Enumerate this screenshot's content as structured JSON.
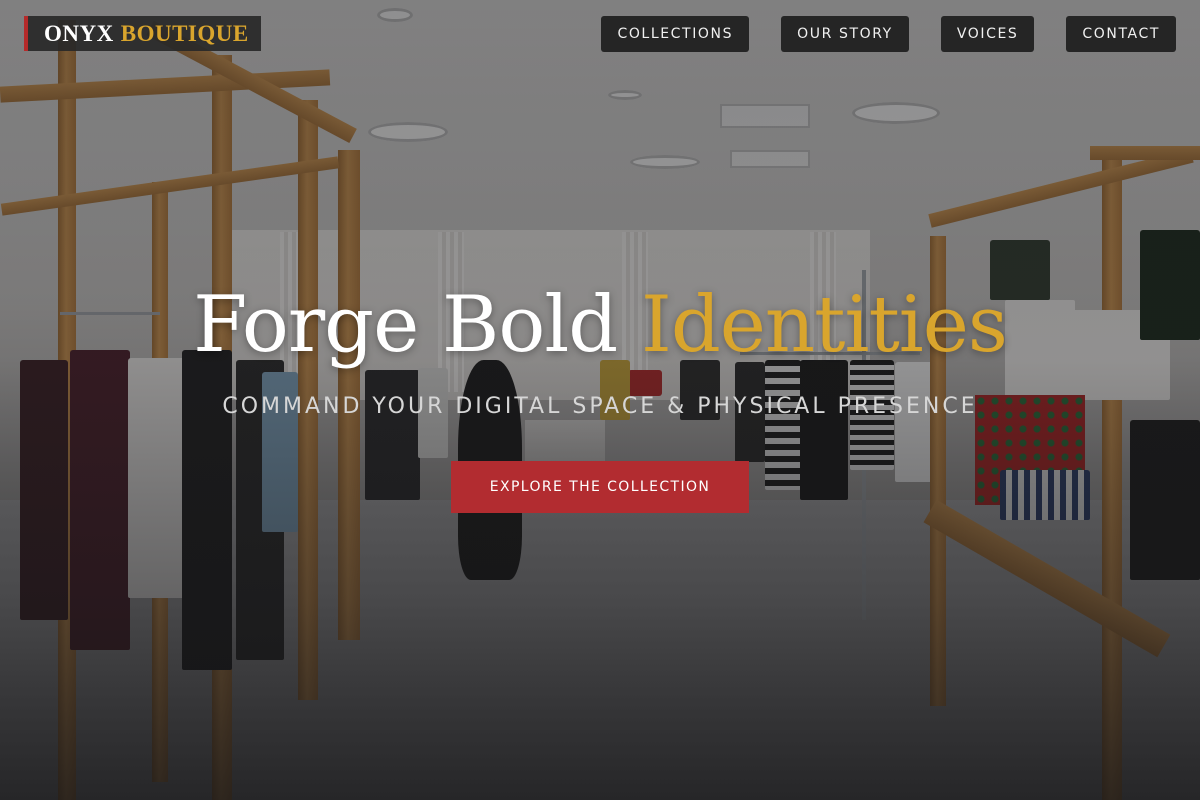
{
  "brand": {
    "word1": "ONYX",
    "word2": "BOUTIQUE",
    "accent_color": "#d9a52d",
    "bar_color": "#b52a2a"
  },
  "nav": {
    "items": [
      {
        "label": "COLLECTIONS"
      },
      {
        "label": "OUR STORY"
      },
      {
        "label": "VOICES"
      },
      {
        "label": "CONTACT"
      }
    ]
  },
  "hero": {
    "headline_part1": "Forge Bold",
    "headline_part2": "Identities",
    "subheadline": "COMMAND YOUR DIGITAL SPACE & PHYSICAL PRESENCE",
    "cta_label": "EXPLORE THE COLLECTION",
    "cta_color": "#b22c30",
    "background": "clothing-store-interior-photo"
  }
}
